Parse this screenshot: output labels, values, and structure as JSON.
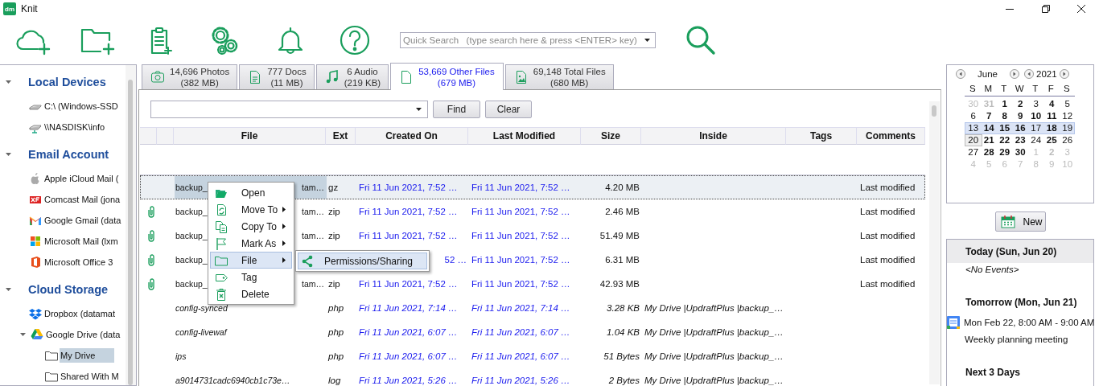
{
  "window": {
    "app_icon": "dm",
    "title": "Knit"
  },
  "toolbar": {
    "search": {
      "placeholder": "Quick Search   (type search here & press <ENTER> key)"
    }
  },
  "sidebar": {
    "groups": [
      {
        "label": "Local Devices",
        "expanded": true,
        "items": [
          {
            "label": "C:\\ (Windows-SSD",
            "selected": false
          },
          {
            "label": "\\\\NASDISK\\info",
            "selected": false
          }
        ]
      },
      {
        "label": "Email Account",
        "expanded": true,
        "items": [
          {
            "label": "Apple iCloud Mail (",
            "selected": false
          },
          {
            "label": "Comcast Mail (jona",
            "selected": false
          },
          {
            "label": "Google Gmail (data",
            "selected": false
          },
          {
            "label": "Microsoft Mail (lxm",
            "selected": false
          },
          {
            "label": "Microsoft Office 3",
            "selected": false
          }
        ]
      },
      {
        "label": "Cloud Storage",
        "expanded": true,
        "items": [
          {
            "label": "Dropbox (datamat",
            "selected": false
          },
          {
            "label": "Google Drive (data",
            "selected": false,
            "expanded": true,
            "children": [
              {
                "label": "My Drive",
                "selected": true
              },
              {
                "label": "Shared With M",
                "selected": false
              }
            ]
          }
        ]
      }
    ]
  },
  "tabs": [
    {
      "count": "14,696 Photos",
      "size": "(382 MB)",
      "selected": false
    },
    {
      "count": "777 Docs",
      "size": "(11 MB)",
      "selected": false
    },
    {
      "count": "6 Audio",
      "size": "(219 KB)",
      "selected": false
    },
    {
      "count": "53,669 Other Files",
      "size": "(679 MB)",
      "selected": true
    },
    {
      "count": "69,148 Total Files",
      "size": "(680 MB)",
      "selected": false
    }
  ],
  "find_bar": {
    "buttons": [
      "Find",
      "Clear"
    ]
  },
  "table": {
    "columns": [
      "File",
      "Ext",
      "Created On",
      "Last Modified",
      "Size",
      "Inside",
      "Tags",
      "Comments"
    ],
    "rows": [
      {
        "kind": "archive",
        "attached": false,
        "selected": true,
        "file": "backup_",
        "file_tail": "tam…",
        "ext": "gz",
        "created": "Fri 11 Jun 2021, 7:52 …",
        "modified": "Fri 11 Jun 2021, 7:52 …",
        "size": "4.20 MB",
        "comments": "Last modified"
      },
      {
        "kind": "archive",
        "attached": true,
        "selected": false,
        "file": "backup_",
        "file_tail": "tam…",
        "ext": "zip",
        "created": "Fri 11 Jun 2021, 7:52 …",
        "modified": "Fri 11 Jun 2021, 7:52 …",
        "size": "2.46 MB",
        "comments": "Last modified"
      },
      {
        "kind": "archive",
        "attached": true,
        "selected": false,
        "file": "backup_",
        "file_tail": "tam…",
        "ext": "zip",
        "created": "Fri 11 Jun 2021, 7:52 …",
        "modified": "Fri 11 Jun 2021, 7:52 …",
        "size": "51.49 MB",
        "comments": "Last modified"
      },
      {
        "kind": "archive",
        "attached": true,
        "selected": false,
        "file": "backup_",
        "created": "52 …",
        "created_cut": true,
        "modified": "Fri 11 Jun 2021, 7:52 …",
        "size": "6.31 MB",
        "comments": "Last modified"
      },
      {
        "kind": "archive",
        "attached": true,
        "selected": false,
        "file": "backup_",
        "file_tail": "tam…",
        "ext": "zip",
        "created": "Fri 11 Jun 2021, 7:52 …",
        "modified": "Fri 11 Jun 2021, 7:52 …",
        "size": "42.93 MB",
        "comments": "Last modified"
      },
      {
        "kind": "inner",
        "attached": false,
        "selected": false,
        "file": "config-synced",
        "ext": "php",
        "created": "Fri 11 Jun 2021, 7:14 …",
        "modified": "Fri 11 Jun 2021, 7:14 …",
        "size": "3.28 KB",
        "inside": "My Drive |UpdraftPlus |backup_…"
      },
      {
        "kind": "inner",
        "attached": false,
        "selected": false,
        "file": "config-livewaf",
        "ext": "php",
        "created": "Fri 11 Jun 2021, 6:07 …",
        "modified": "Fri 11 Jun 2021, 6:07 …",
        "size": "1.04 KB",
        "inside": "My Drive |UpdraftPlus |backup_…"
      },
      {
        "kind": "inner",
        "attached": false,
        "selected": false,
        "file": "ips",
        "ext": "php",
        "created": "Fri 11 Jun 2021, 6:07 …",
        "modified": "Fri 11 Jun 2021, 6:07 …",
        "size": "51 Bytes",
        "inside": "My Drive |UpdraftPlus |backup_…"
      },
      {
        "kind": "inner",
        "attached": false,
        "selected": false,
        "file": "a9014731cadc6940cb1c73e…",
        "ext": "log",
        "created": "Fri 11 Jun 2021, 5:26 …",
        "modified": "Fri 11 Jun 2021, 5:26 …",
        "size": "2 Bytes",
        "inside": "My Drive |UpdraftPlus |backup_…"
      }
    ]
  },
  "context_menu": {
    "items": [
      {
        "label": "Open",
        "submenu": false,
        "selected": false
      },
      {
        "label": "Move To",
        "submenu": true,
        "selected": false
      },
      {
        "label": "Copy To",
        "submenu": true,
        "selected": false
      },
      {
        "label": "Mark As",
        "submenu": true,
        "selected": false
      },
      {
        "label": "File",
        "submenu": true,
        "selected": true
      },
      {
        "label": "Tag",
        "submenu": false,
        "selected": false
      },
      {
        "label": "Delete",
        "submenu": false,
        "selected": false
      }
    ],
    "submenu": {
      "items": [
        {
          "label": "Permissions/Sharing",
          "selected": true
        }
      ]
    }
  },
  "calendar": {
    "month": "June",
    "year": "2021",
    "weekdays": [
      "S",
      "M",
      "T",
      "W",
      "T",
      "F",
      "S"
    ],
    "weeks": [
      {
        "selected": false,
        "days": [
          {
            "n": "30",
            "other": true,
            "bold": false,
            "today": false
          },
          {
            "n": "31",
            "other": true,
            "bold": true,
            "today": false
          },
          {
            "n": "1",
            "other": false,
            "bold": true,
            "today": false
          },
          {
            "n": "2",
            "other": false,
            "bold": true,
            "today": false
          },
          {
            "n": "3",
            "other": false,
            "bold": false,
            "today": false
          },
          {
            "n": "4",
            "other": false,
            "bold": true,
            "today": false
          },
          {
            "n": "5",
            "other": false,
            "bold": false,
            "today": false
          }
        ]
      },
      {
        "selected": false,
        "days": [
          {
            "n": "6",
            "other": false,
            "bold": false,
            "today": false
          },
          {
            "n": "7",
            "other": false,
            "bold": true,
            "today": false
          },
          {
            "n": "8",
            "other": false,
            "bold": true,
            "today": false
          },
          {
            "n": "9",
            "other": false,
            "bold": true,
            "today": false
          },
          {
            "n": "10",
            "other": false,
            "bold": true,
            "today": false
          },
          {
            "n": "11",
            "other": false,
            "bold": true,
            "today": false
          },
          {
            "n": "12",
            "other": false,
            "bold": false,
            "today": false
          }
        ]
      },
      {
        "selected": true,
        "days": [
          {
            "n": "13",
            "other": false,
            "bold": false,
            "today": false
          },
          {
            "n": "14",
            "other": false,
            "bold": true,
            "today": false
          },
          {
            "n": "15",
            "other": false,
            "bold": true,
            "today": false
          },
          {
            "n": "16",
            "other": false,
            "bold": true,
            "today": false
          },
          {
            "n": "17",
            "other": false,
            "bold": false,
            "today": false
          },
          {
            "n": "18",
            "other": false,
            "bold": true,
            "today": false
          },
          {
            "n": "19",
            "other": false,
            "bold": false,
            "today": false
          }
        ]
      },
      {
        "selected": false,
        "days": [
          {
            "n": "20",
            "other": false,
            "bold": false,
            "today": true
          },
          {
            "n": "21",
            "other": false,
            "bold": true,
            "today": false
          },
          {
            "n": "22",
            "other": false,
            "bold": true,
            "today": false
          },
          {
            "n": "23",
            "other": false,
            "bold": true,
            "today": false
          },
          {
            "n": "24",
            "other": false,
            "bold": false,
            "today": false
          },
          {
            "n": "25",
            "other": false,
            "bold": true,
            "today": false
          },
          {
            "n": "26",
            "other": false,
            "bold": false,
            "today": false
          }
        ]
      },
      {
        "selected": false,
        "days": [
          {
            "n": "27",
            "other": false,
            "bold": false,
            "today": false
          },
          {
            "n": "28",
            "other": false,
            "bold": true,
            "today": false
          },
          {
            "n": "29",
            "other": false,
            "bold": true,
            "today": false
          },
          {
            "n": "30",
            "other": false,
            "bold": true,
            "today": false
          },
          {
            "n": "1",
            "other": true,
            "bold": false,
            "today": false
          },
          {
            "n": "2",
            "other": true,
            "bold": true,
            "today": false
          },
          {
            "n": "3",
            "other": true,
            "bold": false,
            "today": false
          }
        ]
      },
      {
        "selected": false,
        "days": [
          {
            "n": "4",
            "other": true,
            "bold": false,
            "today": false
          },
          {
            "n": "5",
            "other": true,
            "bold": false,
            "today": false
          },
          {
            "n": "6",
            "other": true,
            "bold": false,
            "today": false
          },
          {
            "n": "7",
            "other": true,
            "bold": false,
            "today": false
          },
          {
            "n": "8",
            "other": true,
            "bold": false,
            "today": false
          },
          {
            "n": "9",
            "other": true,
            "bold": false,
            "today": false
          },
          {
            "n": "10",
            "other": true,
            "bold": false,
            "today": false
          }
        ]
      }
    ]
  },
  "new_button": "New",
  "agenda": {
    "sections": [
      {
        "title": "Today (Sun, Jun 20)",
        "current": true,
        "items": [
          {
            "kind": "empty",
            "text": "<No Events>"
          }
        ]
      },
      {
        "title": "Tomorrow (Mon, Jun 21)",
        "current": false,
        "items": [
          {
            "kind": "event",
            "time": "Mon Feb 22, 8:00 AM - 9:00 AM",
            "text": "Weekly planning meeting"
          }
        ]
      },
      {
        "title": "Next 3 Days",
        "current": false
      }
    ]
  }
}
